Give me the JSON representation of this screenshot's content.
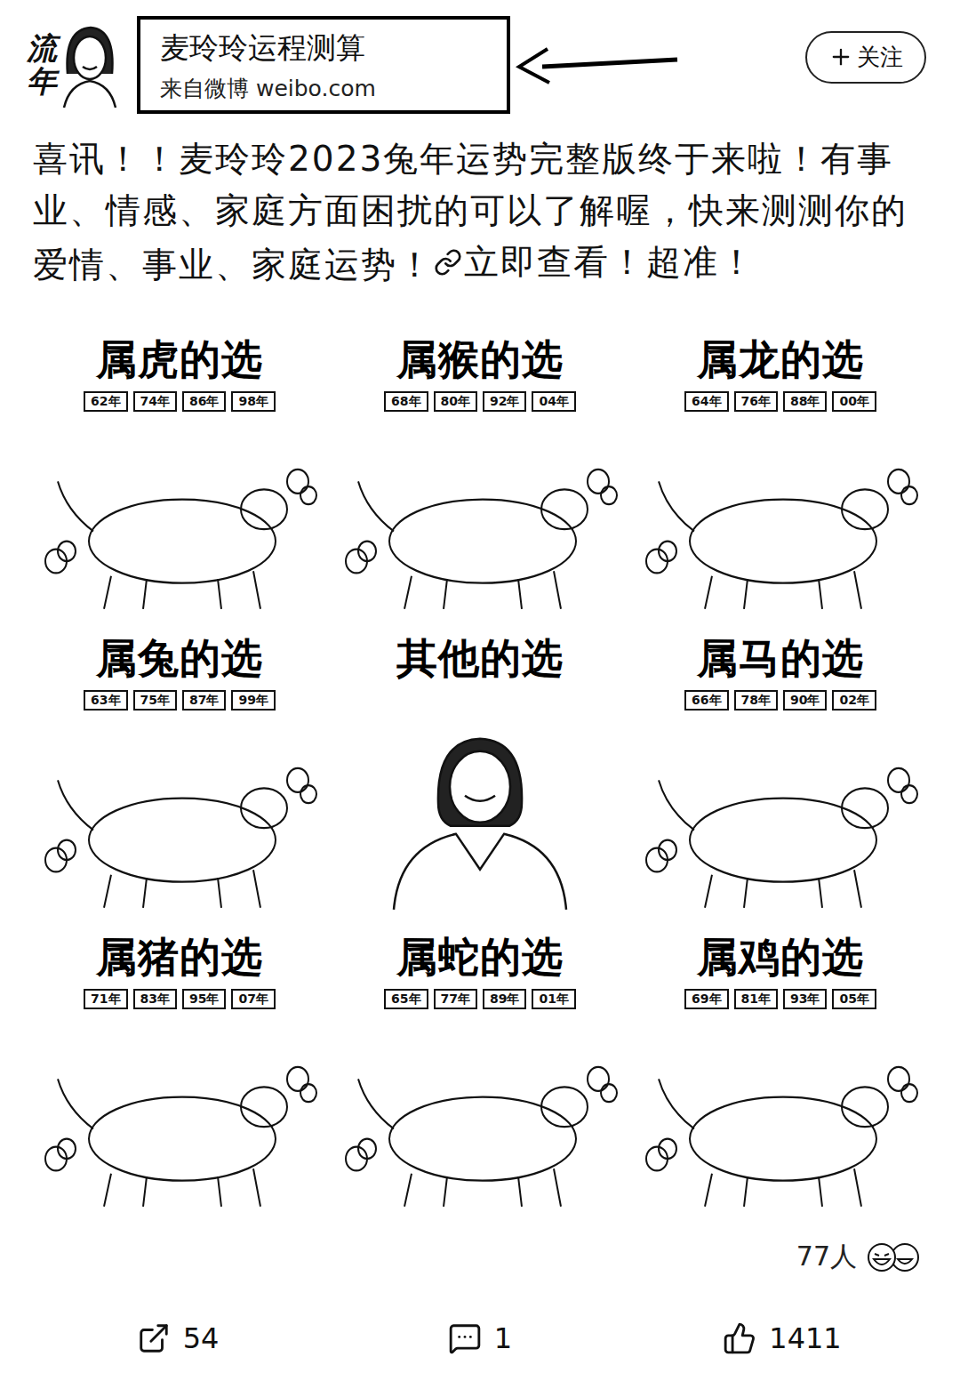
{
  "account": {
    "avatar_text": "流年",
    "name": "麦玲玲运程测算",
    "source": "来自微博 weibo.com",
    "follow": "关注"
  },
  "post": {
    "text": "喜讯！！麦玲玲2023兔年运势完整版终于来啦！有事业、情感、家庭方面困扰的可以了解喔，快来测测你的爱情、事业、家庭运势！",
    "link": "立即查看！超准！"
  },
  "images": [
    {
      "title": "属虎的选",
      "kind": "animal",
      "years": [
        "62年",
        "74年",
        "86年",
        "98年"
      ]
    },
    {
      "title": "属猴的选",
      "kind": "animal",
      "years": [
        "68年",
        "80年",
        "92年",
        "04年"
      ]
    },
    {
      "title": "属龙的选",
      "kind": "animal",
      "years": [
        "64年",
        "76年",
        "88年",
        "00年"
      ]
    },
    {
      "title": "属兔的选",
      "kind": "animal",
      "years": [
        "63年",
        "75年",
        "87年",
        "99年"
      ]
    },
    {
      "title": "其他的选",
      "kind": "portrait",
      "years": []
    },
    {
      "title": "属马的选",
      "kind": "animal",
      "years": [
        "66年",
        "78年",
        "90年",
        "02年"
      ]
    },
    {
      "title": "属猪的选",
      "kind": "animal",
      "years": [
        "71年",
        "83年",
        "95年",
        "07年"
      ]
    },
    {
      "title": "属蛇的选",
      "kind": "animal",
      "years": [
        "65年",
        "77年",
        "89年",
        "01年"
      ]
    },
    {
      "title": "属鸡的选",
      "kind": "animal",
      "years": [
        "69年",
        "81年",
        "93年",
        "05年"
      ]
    }
  ],
  "reactions": {
    "count": "77人"
  },
  "actions": [
    {
      "kind": "share",
      "count": "54"
    },
    {
      "kind": "comment",
      "count": "1"
    },
    {
      "kind": "like",
      "count": "1411"
    }
  ]
}
